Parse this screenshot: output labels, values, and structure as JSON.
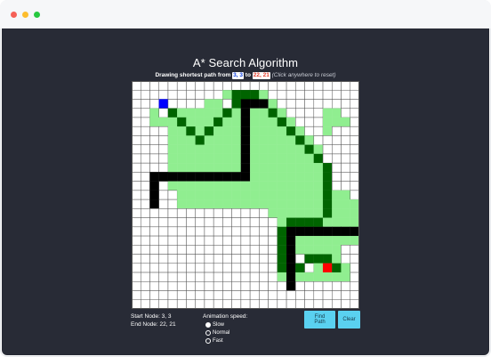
{
  "window": {
    "controls": {
      "close_color": "#f56057",
      "minimize_color": "#fdbd2e",
      "maximize_color": "#27c840"
    }
  },
  "app": {
    "title": "A* Search Algorithm",
    "subtitle_prefix": "Drawing shortest path from",
    "start_label": "3, 3",
    "connector": "to",
    "end_label": "22, 21",
    "hint": "(Click anywhere to reset)"
  },
  "grid": {
    "cols": 25,
    "rows": 25,
    "start": [
      3,
      2
    ],
    "end": [
      21,
      20
    ],
    "colors": {
      "empty": "#ffffff",
      "gridline": "#555555",
      "visited": "#90ee90",
      "path": "#006400",
      "wall": "#000000",
      "start": "#0000ff",
      "end": "#ff0000"
    },
    "visited_cells": [
      [
        2,
        3
      ],
      [
        4,
        11
      ],
      [
        5,
        13
      ],
      [
        2,
        4
      ],
      [
        3,
        4
      ],
      [
        4,
        4
      ],
      [
        4,
        5
      ],
      [
        4,
        6
      ],
      [
        4,
        7
      ],
      [
        4,
        8
      ],
      [
        4,
        9
      ],
      [
        4,
        10
      ],
      [
        5,
        3
      ],
      [
        5,
        4
      ],
      [
        5,
        5
      ],
      [
        5,
        6
      ],
      [
        5,
        7
      ],
      [
        5,
        8
      ],
      [
        5,
        9
      ],
      [
        5,
        10
      ],
      [
        5,
        11
      ],
      [
        5,
        12
      ],
      [
        5,
        13
      ],
      [
        6,
        3
      ],
      [
        6,
        4
      ],
      [
        6,
        5
      ],
      [
        6,
        6
      ],
      [
        6,
        7
      ],
      [
        6,
        8
      ],
      [
        6,
        9
      ],
      [
        6,
        10
      ],
      [
        6,
        11
      ],
      [
        6,
        12
      ],
      [
        6,
        13
      ],
      [
        7,
        3
      ],
      [
        7,
        4
      ],
      [
        7,
        5
      ],
      [
        7,
        6
      ],
      [
        7,
        7
      ],
      [
        7,
        8
      ],
      [
        7,
        9
      ],
      [
        7,
        10
      ],
      [
        7,
        11
      ],
      [
        7,
        12
      ],
      [
        7,
        13
      ],
      [
        8,
        3
      ],
      [
        8,
        4
      ],
      [
        8,
        5
      ],
      [
        8,
        6
      ],
      [
        8,
        7
      ],
      [
        8,
        8
      ],
      [
        8,
        9
      ],
      [
        8,
        10
      ],
      [
        8,
        11
      ],
      [
        8,
        12
      ],
      [
        8,
        13
      ],
      [
        9,
        3
      ],
      [
        9,
        4
      ],
      [
        9,
        5
      ],
      [
        9,
        6
      ],
      [
        9,
        7
      ],
      [
        9,
        8
      ],
      [
        9,
        9
      ],
      [
        9,
        10
      ],
      [
        9,
        11
      ],
      [
        9,
        12
      ],
      [
        9,
        13
      ],
      [
        10,
        3
      ],
      [
        10,
        4
      ],
      [
        10,
        5
      ],
      [
        10,
        6
      ],
      [
        10,
        7
      ],
      [
        10,
        8
      ],
      [
        10,
        9
      ],
      [
        10,
        10
      ],
      [
        10,
        11
      ],
      [
        10,
        12
      ],
      [
        10,
        13
      ],
      [
        11,
        3
      ],
      [
        11,
        4
      ],
      [
        11,
        5
      ],
      [
        11,
        6
      ],
      [
        11,
        7
      ],
      [
        11,
        8
      ],
      [
        11,
        9
      ],
      [
        11,
        10
      ],
      [
        11,
        11
      ],
      [
        11,
        12
      ],
      [
        11,
        13
      ],
      [
        12,
        3
      ],
      [
        12,
        4
      ],
      [
        12,
        5
      ],
      [
        12,
        6
      ],
      [
        12,
        7
      ],
      [
        12,
        8
      ],
      [
        12,
        9
      ],
      [
        12,
        10
      ],
      [
        12,
        11
      ],
      [
        12,
        12
      ],
      [
        12,
        13
      ],
      [
        13,
        3
      ],
      [
        13,
        4
      ],
      [
        13,
        5
      ],
      [
        13,
        6
      ],
      [
        13,
        7
      ],
      [
        13,
        8
      ],
      [
        13,
        9
      ],
      [
        13,
        10
      ],
      [
        13,
        11
      ],
      [
        13,
        12
      ],
      [
        13,
        13
      ],
      [
        14,
        3
      ],
      [
        14,
        4
      ],
      [
        14,
        5
      ],
      [
        14,
        6
      ],
      [
        14,
        7
      ],
      [
        14,
        8
      ],
      [
        14,
        9
      ],
      [
        14,
        10
      ],
      [
        14,
        11
      ],
      [
        14,
        12
      ],
      [
        14,
        13
      ],
      [
        15,
        3
      ],
      [
        15,
        4
      ],
      [
        15,
        5
      ],
      [
        15,
        6
      ],
      [
        15,
        7
      ],
      [
        15,
        8
      ],
      [
        15,
        9
      ],
      [
        15,
        10
      ],
      [
        15,
        11
      ],
      [
        15,
        12
      ],
      [
        15,
        13
      ],
      [
        15,
        14
      ],
      [
        16,
        4
      ],
      [
        16,
        5
      ],
      [
        16,
        6
      ],
      [
        16,
        7
      ],
      [
        16,
        8
      ],
      [
        16,
        9
      ],
      [
        16,
        10
      ],
      [
        16,
        11
      ],
      [
        16,
        12
      ],
      [
        16,
        13
      ],
      [
        16,
        14
      ],
      [
        16,
        15
      ],
      [
        17,
        5
      ],
      [
        17,
        6
      ],
      [
        17,
        7
      ],
      [
        17,
        8
      ],
      [
        17,
        9
      ],
      [
        17,
        10
      ],
      [
        17,
        11
      ],
      [
        17,
        12
      ],
      [
        17,
        13
      ],
      [
        17,
        14
      ],
      [
        17,
        15
      ],
      [
        17,
        16
      ],
      [
        18,
        6
      ],
      [
        18,
        7
      ],
      [
        18,
        8
      ],
      [
        18,
        9
      ],
      [
        18,
        10
      ],
      [
        18,
        11
      ],
      [
        18,
        12
      ],
      [
        18,
        13
      ],
      [
        18,
        14
      ],
      [
        18,
        15
      ],
      [
        18,
        16
      ],
      [
        18,
        17
      ],
      [
        19,
        7
      ],
      [
        19,
        8
      ],
      [
        19,
        9
      ],
      [
        19,
        10
      ],
      [
        19,
        11
      ],
      [
        19,
        12
      ],
      [
        19,
        13
      ],
      [
        19,
        14
      ],
      [
        19,
        15
      ],
      [
        19,
        16
      ],
      [
        19,
        17
      ],
      [
        20,
        8
      ],
      [
        20,
        9
      ],
      [
        20,
        10
      ],
      [
        20,
        11
      ],
      [
        20,
        12
      ],
      [
        20,
        13
      ],
      [
        20,
        14
      ],
      [
        20,
        15
      ],
      [
        20,
        16
      ],
      [
        20,
        17
      ],
      [
        21,
        13
      ],
      [
        21,
        14
      ],
      [
        21,
        15
      ],
      [
        21,
        16
      ],
      [
        21,
        17
      ],
      [
        22,
        13
      ],
      [
        22,
        14
      ],
      [
        22,
        15
      ],
      [
        22,
        16
      ],
      [
        22,
        17
      ],
      [
        23,
        13
      ],
      [
        23,
        14
      ],
      [
        23,
        15
      ],
      [
        23,
        16
      ],
      [
        23,
        17
      ],
      [
        24,
        14
      ],
      [
        24,
        15
      ],
      [
        24,
        16
      ],
      [
        11,
        1
      ],
      [
        12,
        1
      ],
      [
        13,
        1
      ],
      [
        11,
        2
      ],
      [
        12,
        2
      ],
      [
        13,
        2
      ],
      [
        14,
        2
      ],
      [
        10,
        1
      ],
      [
        9,
        2
      ],
      [
        8,
        2
      ],
      [
        21,
        3
      ],
      [
        21,
        4
      ],
      [
        21,
        5
      ],
      [
        22,
        3
      ],
      [
        22,
        4
      ],
      [
        23,
        4
      ],
      [
        16,
        3
      ],
      [
        17,
        4
      ],
      [
        18,
        5
      ],
      [
        19,
        6
      ],
      [
        20,
        7
      ],
      [
        14,
        1
      ],
      [
        15,
        2
      ],
      [
        24,
        13
      ],
      [
        24,
        17
      ],
      [
        25,
        17
      ],
      [
        16,
        19
      ],
      [
        17,
        18
      ],
      [
        23,
        12
      ],
      [
        22,
        12
      ],
      [
        21,
        12
      ],
      [
        20,
        18
      ],
      [
        21,
        18
      ],
      [
        22,
        18
      ],
      [
        19,
        18
      ],
      [
        18,
        18
      ],
      [
        17,
        19
      ],
      [
        16,
        20
      ],
      [
        16,
        21
      ],
      [
        17,
        21
      ],
      [
        18,
        21
      ],
      [
        19,
        21
      ],
      [
        20,
        21
      ],
      [
        21,
        21
      ],
      [
        22,
        21
      ],
      [
        23,
        21
      ],
      [
        20,
        20
      ],
      [
        23,
        20
      ],
      [
        22,
        19
      ],
      [
        21,
        19
      ],
      [
        20,
        19
      ]
    ],
    "wall_cells": [
      [
        2,
        10
      ],
      [
        2,
        11
      ],
      [
        2,
        12
      ],
      [
        2,
        13
      ],
      [
        3,
        10
      ],
      [
        4,
        10
      ],
      [
        5,
        10
      ],
      [
        6,
        10
      ],
      [
        7,
        10
      ],
      [
        8,
        10
      ],
      [
        9,
        10
      ],
      [
        10,
        10
      ],
      [
        11,
        10
      ],
      [
        12,
        10
      ],
      [
        12,
        9
      ],
      [
        12,
        8
      ],
      [
        12,
        7
      ],
      [
        12,
        6
      ],
      [
        12,
        5
      ],
      [
        12,
        4
      ],
      [
        12,
        3
      ],
      [
        12,
        2
      ],
      [
        13,
        2
      ],
      [
        14,
        2
      ],
      [
        17,
        16
      ],
      [
        17,
        17
      ],
      [
        17,
        18
      ],
      [
        17,
        19
      ],
      [
        17,
        20
      ],
      [
        17,
        21
      ],
      [
        17,
        22
      ],
      [
        18,
        16
      ],
      [
        19,
        16
      ],
      [
        20,
        16
      ],
      [
        21,
        16
      ],
      [
        22,
        16
      ],
      [
        23,
        16
      ],
      [
        24,
        16
      ],
      [
        25,
        16
      ]
    ],
    "path_cells": [
      [
        3,
        2
      ],
      [
        4,
        3
      ],
      [
        5,
        4
      ],
      [
        6,
        5
      ],
      [
        7,
        6
      ],
      [
        8,
        5
      ],
      [
        9,
        4
      ],
      [
        10,
        3
      ],
      [
        11,
        2
      ],
      [
        11,
        1
      ],
      [
        12,
        1
      ],
      [
        13,
        1
      ],
      [
        14,
        2
      ],
      [
        15,
        3
      ],
      [
        16,
        4
      ],
      [
        17,
        5
      ],
      [
        18,
        6
      ],
      [
        19,
        7
      ],
      [
        20,
        8
      ],
      [
        21,
        9
      ],
      [
        21,
        10
      ],
      [
        21,
        11
      ],
      [
        21,
        12
      ],
      [
        21,
        13
      ],
      [
        21,
        14
      ],
      [
        20,
        15
      ],
      [
        19,
        15
      ],
      [
        18,
        15
      ],
      [
        17,
        15
      ],
      [
        16,
        16
      ],
      [
        16,
        17
      ],
      [
        16,
        18
      ],
      [
        16,
        19
      ],
      [
        16,
        20
      ],
      [
        17,
        21
      ],
      [
        18,
        20
      ],
      [
        19,
        19
      ],
      [
        20,
        19
      ],
      [
        21,
        19
      ],
      [
        22,
        20
      ]
    ]
  },
  "info": {
    "start_text": "Start Node: 3, 3",
    "end_text": "End Node: 22, 21"
  },
  "speed": {
    "title": "Animation speed:",
    "options": [
      {
        "label": "Slow",
        "checked": true
      },
      {
        "label": "Normal",
        "checked": false
      },
      {
        "label": "Fast",
        "checked": false
      }
    ]
  },
  "buttons": {
    "find_path": "Find Path",
    "clear": "Clear"
  }
}
